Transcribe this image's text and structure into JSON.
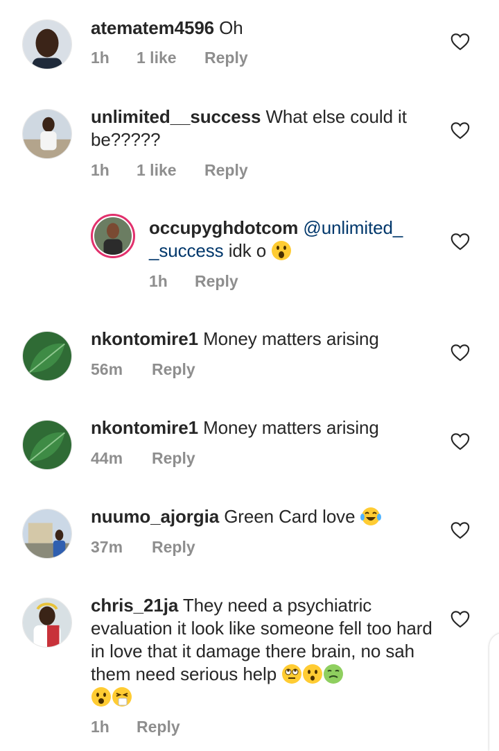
{
  "comments": [
    {
      "username": "atematem4596",
      "text": "Oh",
      "time": "1h",
      "likes": "1 like",
      "reply": "Reply",
      "avatar_icon": "avatar-photo",
      "like_icon": "heart-outline-icon"
    },
    {
      "username": "unlimited__success",
      "text": "What else could it be?????",
      "time": "1h",
      "likes": "1 like",
      "reply": "Reply",
      "avatar_icon": "avatar-photo",
      "like_icon": "heart-outline-icon"
    },
    {
      "username": "occupyghdotcom",
      "mention": "@unlimited_\n_success",
      "text": "idk o",
      "emoji": "astonished-face-emoji",
      "time": "1h",
      "reply": "Reply",
      "avatar_icon": "avatar-photo-story-ring",
      "like_icon": "heart-outline-icon"
    },
    {
      "username": "nkontomire1",
      "text": "Money matters arising",
      "time": "56m",
      "reply": "Reply",
      "avatar_icon": "avatar-leaf-photo",
      "like_icon": "heart-outline-icon"
    },
    {
      "username": "nkontomire1",
      "text": "Money matters arising",
      "time": "44m",
      "reply": "Reply",
      "avatar_icon": "avatar-leaf-photo",
      "like_icon": "heart-outline-icon"
    },
    {
      "username": "nuumo_ajorgia",
      "text": "Green Card love",
      "emoji": "tears-of-joy-emoji",
      "time": "37m",
      "reply": "Reply",
      "avatar_icon": "avatar-photo",
      "like_icon": "heart-outline-icon"
    },
    {
      "username": "chris_21ja",
      "text": "They need a psychiatric evaluation it look like someone fell too hard in love that it damage there brain, no sah them need serious help",
      "emojis": [
        "rolling-eyes-emoji",
        "hushed-face-emoji",
        "nauseated-face-emoji",
        "frowning-open-mouth-emoji",
        "sneezing-face-emoji"
      ],
      "time": "1h",
      "reply": "Reply",
      "avatar_icon": "avatar-photo",
      "like_icon": "heart-outline-icon"
    }
  ],
  "colors": {
    "text": "#262626",
    "meta": "#8e8e8e",
    "mention": "#00376b",
    "story_ring_start": "#f58529",
    "story_ring_end": "#dd2a7b"
  }
}
